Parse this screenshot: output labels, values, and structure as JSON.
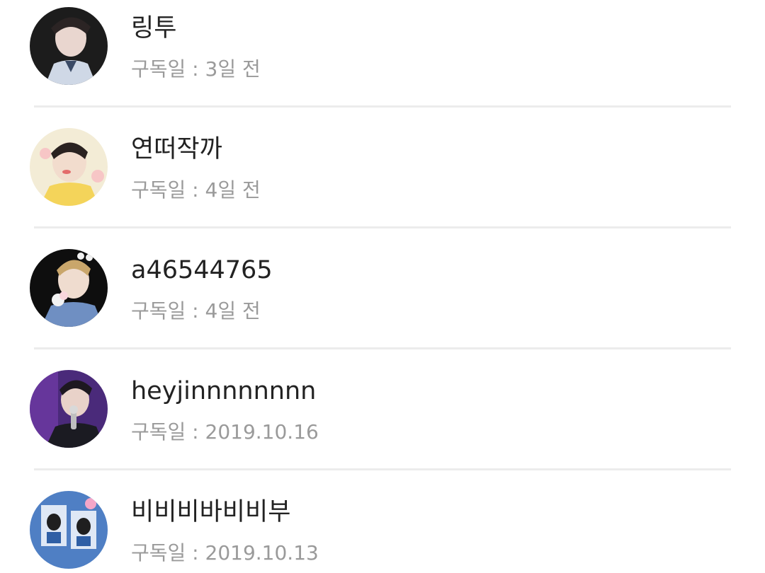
{
  "subscribers": [
    {
      "name": "링투",
      "subscribed": "구독일 : 3일 전",
      "avatar_icon": "user-photo-avatar",
      "avatar_bg": "#1c1c1c",
      "avatar_accent": "#e9d6cf"
    },
    {
      "name": "연떠작까",
      "subscribed": "구독일 : 4일 전",
      "avatar_icon": "user-photo-avatar",
      "avatar_bg": "#f3ecd6",
      "avatar_accent": "#f4d45a"
    },
    {
      "name": "a46544765",
      "subscribed": "구독일 : 4일 전",
      "avatar_icon": "user-photo-avatar",
      "avatar_bg": "#0e0e0e",
      "avatar_accent": "#6f8fc2"
    },
    {
      "name": "heyjinnnnnnnn",
      "subscribed": "구독일 : 2019.10.16",
      "avatar_icon": "user-photo-avatar",
      "avatar_bg": "#4a2a7a",
      "avatar_accent": "#c9b3e6"
    },
    {
      "name": "비비비바비비부",
      "subscribed": "구독일 : 2019.10.13",
      "avatar_icon": "user-photo-avatar",
      "avatar_bg": "#4f7fc4",
      "avatar_accent": "#dfe8f5"
    }
  ]
}
